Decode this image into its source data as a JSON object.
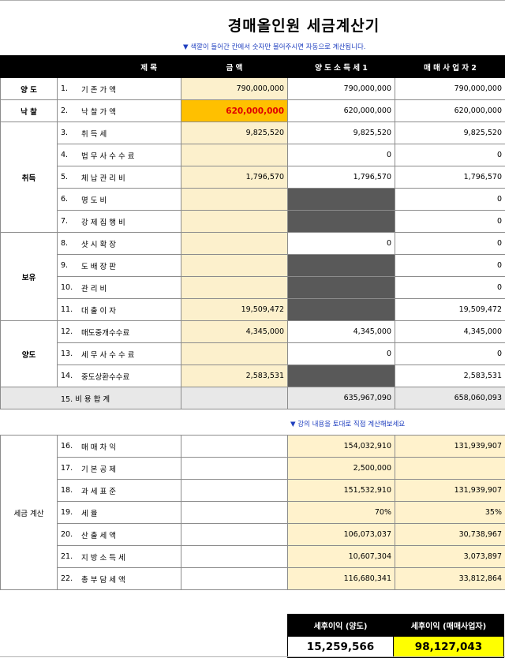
{
  "title": "경매올인원 세금계산기",
  "note_top": "▼  색깔이 들어간 칸에서 숫자만 불어주시면 자동으로 계산됩니다.",
  "note_mid": "▼  강의 내용을 토대로 직접 계산해보세요",
  "header": {
    "item": "제        목",
    "amount": "금        액",
    "col1": "양 도 소 득 세 1",
    "col2": "매 매 사 업 자 2"
  },
  "groups": {
    "transfer": "양   도",
    "bid": "낙   찰",
    "acquire": "취득",
    "hold": "보유",
    "sell": "양도",
    "tax": "세금 계산"
  },
  "rows": [
    {
      "no": "1.",
      "label": "기 존 가 액",
      "amount": "790,000,000",
      "v1": "790,000,000",
      "v2": "790,000,000"
    },
    {
      "no": "2.",
      "label": "낙 찰 가 액",
      "amount": "620,000,000",
      "v1": "620,000,000",
      "v2": "620,000,000"
    },
    {
      "no": "3.",
      "label": "취 득 세",
      "amount": "9,825,520",
      "v1": "9,825,520",
      "v2": "9,825,520"
    },
    {
      "no": "4.",
      "label": "법 무 사 수 수 료",
      "amount": "",
      "v1": "0",
      "v2": "0"
    },
    {
      "no": "5.",
      "label": "체 납 관 리 비",
      "amount": "1,796,570",
      "v1": "1,796,570",
      "v2": "1,796,570"
    },
    {
      "no": "6.",
      "label": "명 도 비",
      "amount": "",
      "v1": "",
      "v2": "0"
    },
    {
      "no": "7.",
      "label": "강 제 집 행 비",
      "amount": "",
      "v1": "",
      "v2": "0"
    },
    {
      "no": "8.",
      "label": "샷 시 확 장",
      "amount": "",
      "v1": "0",
      "v2": "0"
    },
    {
      "no": "9.",
      "label": "도 배 장 판",
      "amount": "",
      "v1": "",
      "v2": "0"
    },
    {
      "no": "10.",
      "label": "관 리 비",
      "amount": "",
      "v1": "",
      "v2": "0"
    },
    {
      "no": "11.",
      "label": "대 출 이 자",
      "amount": "19,509,472",
      "v1": "",
      "v2": "19,509,472"
    },
    {
      "no": "12.",
      "label": "매도중개수수료",
      "amount": "4,345,000",
      "v1": "4,345,000",
      "v2": "4,345,000"
    },
    {
      "no": "13.",
      "label": "세 무 사 수 수 료",
      "amount": "",
      "v1": "0",
      "v2": "0"
    },
    {
      "no": "14.",
      "label": "중도상환수수료",
      "amount": "2,583,531",
      "v1": "",
      "v2": "2,583,531"
    }
  ],
  "sum": {
    "label": "15. 비 용 합 계",
    "v1": "635,967,090",
    "v2": "658,060,093"
  },
  "calc": [
    {
      "no": "16.",
      "label": "매 매 차 익",
      "v1": "154,032,910",
      "v2": "131,939,907"
    },
    {
      "no": "17.",
      "label": "기 본 공 제",
      "v1": "2,500,000",
      "v2": ""
    },
    {
      "no": "18.",
      "label": "과 세 표 준",
      "v1": "151,532,910",
      "v2": "131,939,907"
    },
    {
      "no": "19.",
      "label": "세 율",
      "v1": "70%",
      "v2": "35%"
    },
    {
      "no": "20.",
      "label": "산 출 세 액",
      "v1": "106,073,037",
      "v2": "30,738,967"
    },
    {
      "no": "21.",
      "label": "지 방 소 득 세",
      "v1": "10,607,304",
      "v2": "3,073,897"
    },
    {
      "no": "22.",
      "label": "총 부 담 세 액",
      "v1": "116,680,341",
      "v2": "33,812,864"
    }
  ],
  "result": {
    "h1": "세후이익 (양도)",
    "h2": "세후이익 (매매사업자)",
    "r1": "15,259,566",
    "r2": "98,127,043"
  },
  "colors": {
    "input": "#fcf0cc",
    "highlight": "#ffc000",
    "disabled": "#595959",
    "result_highlight": "#ffff00"
  }
}
